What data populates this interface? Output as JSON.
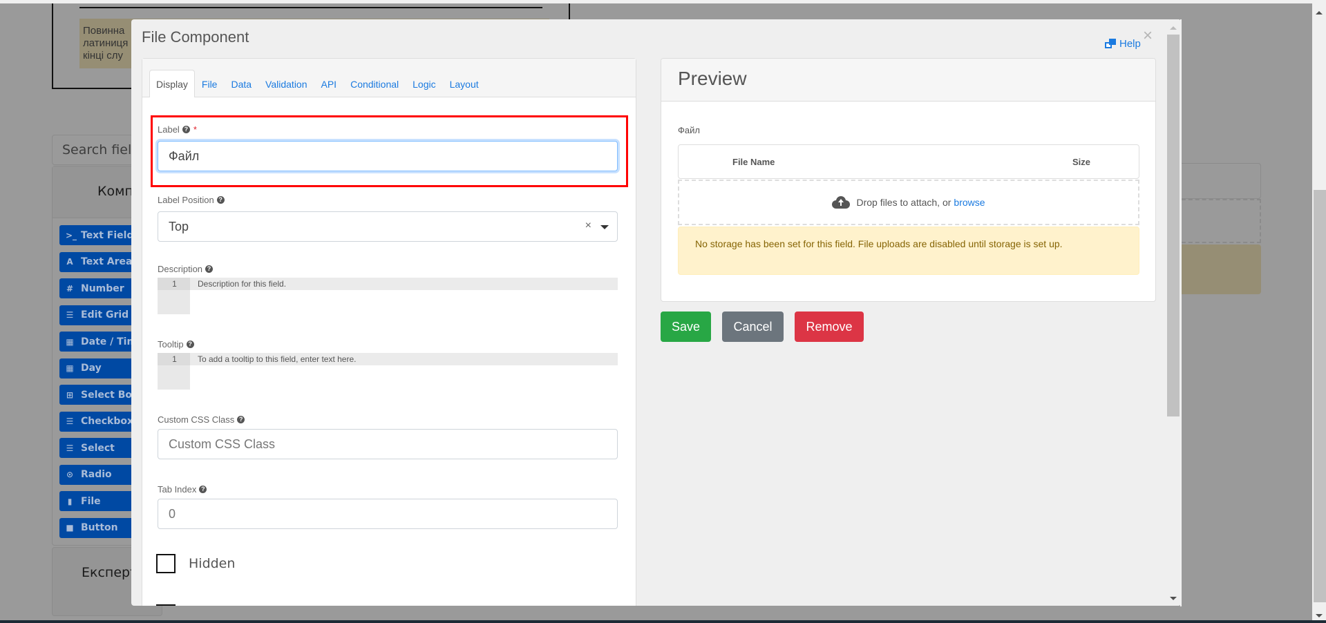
{
  "background": {
    "note_lines": [
      "Повинна",
      "латиниця",
      "кінці слу"
    ],
    "search_placeholder": "Search field(s)",
    "components_title": "Компоненти",
    "components": [
      {
        "icon": "terminal-icon",
        "glyph": ">_",
        "label": "Text Field"
      },
      {
        "icon": "font-icon",
        "glyph": "A",
        "label": "Text Area"
      },
      {
        "icon": "hashtag-icon",
        "glyph": "#",
        "label": "Number"
      },
      {
        "icon": "tasks-icon",
        "glyph": "☰",
        "label": "Edit Grid"
      },
      {
        "icon": "calendar-icon",
        "glyph": "▦",
        "label": "Date / Time"
      },
      {
        "icon": "calendar-icon",
        "glyph": "▦",
        "label": "Day"
      },
      {
        "icon": "plus-square-icon",
        "glyph": "⊞",
        "label": "Select Boxes"
      },
      {
        "icon": "list-icon",
        "glyph": "☰",
        "label": "Checkbox"
      },
      {
        "icon": "list-icon",
        "glyph": "☰",
        "label": "Select"
      },
      {
        "icon": "dot-circle-icon",
        "glyph": "⊙",
        "label": "Radio"
      },
      {
        "icon": "file-icon",
        "glyph": "▮",
        "label": "File"
      },
      {
        "icon": "stop-icon",
        "glyph": "■",
        "label": "Button"
      }
    ],
    "expert_title": "Експерт"
  },
  "modal": {
    "title": "File Component",
    "help_label": "Help",
    "close_glyph": "×",
    "tabs": [
      {
        "label": "Display",
        "active": true
      },
      {
        "label": "File",
        "active": false
      },
      {
        "label": "Data",
        "active": false
      },
      {
        "label": "Validation",
        "active": false
      },
      {
        "label": "API",
        "active": false
      },
      {
        "label": "Conditional",
        "active": false
      },
      {
        "label": "Logic",
        "active": false
      },
      {
        "label": "Layout",
        "active": false
      }
    ],
    "fields": {
      "label": {
        "label": "Label",
        "required_mark": "*",
        "value": "Файл"
      },
      "label_position": {
        "label": "Label Position",
        "value": "Top",
        "clear_glyph": "×"
      },
      "description": {
        "label": "Description",
        "line_number": "1",
        "placeholder": "Description for this field."
      },
      "tooltip": {
        "label": "Tooltip",
        "line_number": "1",
        "placeholder": "To add a tooltip to this field, enter text here."
      },
      "custom_css": {
        "label": "Custom CSS Class",
        "placeholder": "Custom CSS Class"
      },
      "tab_index": {
        "label": "Tab Index",
        "placeholder": "0"
      },
      "hidden": {
        "label": "Hidden",
        "checked": false
      }
    },
    "preview": {
      "title": "Preview",
      "field_label": "Файл",
      "col_file_name": "File Name",
      "col_size": "Size",
      "drop_text": "Drop files to attach, or",
      "browse_label": "browse",
      "warning": "No storage has been set for this field. File uploads are disabled until storage is set up."
    },
    "buttons": {
      "save": "Save",
      "cancel": "Cancel",
      "remove": "Remove"
    }
  },
  "colors": {
    "primary_link": "#1a7ae0",
    "save": "#28a745",
    "cancel": "#6c757d",
    "remove": "#dc3545",
    "highlight": "#ff0000",
    "warning_bg": "#fff2cc",
    "warning_text": "#856404"
  }
}
